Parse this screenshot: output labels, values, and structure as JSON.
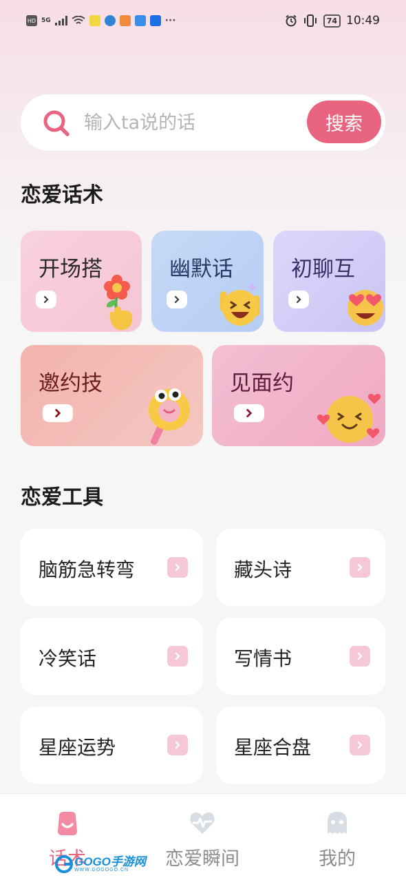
{
  "status_bar": {
    "network_labels": [
      "HD",
      "5G"
    ],
    "battery": "74",
    "time": "10:49"
  },
  "search": {
    "placeholder": "输入ta说的话",
    "button_label": "搜索"
  },
  "sections": {
    "techniques_title": "恋爱话术",
    "tools_title": "恋爱工具"
  },
  "techniques": [
    {
      "label": "开场搭",
      "text_color": "#2a2a2a"
    },
    {
      "label": "幽默话",
      "text_color": "#263a66"
    },
    {
      "label": "初聊互",
      "text_color": "#3b2d66"
    },
    {
      "label": "邀约技",
      "text_color": "#6a1c1c"
    },
    {
      "label": "见面约",
      "text_color": "#5c1b36"
    }
  ],
  "tools": [
    {
      "label": "脑筋急转弯"
    },
    {
      "label": "藏头诗"
    },
    {
      "label": "冷笑话"
    },
    {
      "label": "写情书"
    },
    {
      "label": "星座运势"
    },
    {
      "label": "星座合盘"
    }
  ],
  "nav": {
    "items": [
      {
        "label": "话术",
        "icon": "smile-bag-icon",
        "active": true
      },
      {
        "label": "恋爱瞬间",
        "icon": "heart-pulse-icon",
        "active": false
      },
      {
        "label": "我的",
        "icon": "ghost-avatar-icon",
        "active": false
      }
    ]
  },
  "colors": {
    "accent": "#e8647f",
    "background": "#f6f6f6"
  },
  "watermark": {
    "text": "GOGO手游网",
    "url": "WWW.GOGOGO.CN"
  }
}
